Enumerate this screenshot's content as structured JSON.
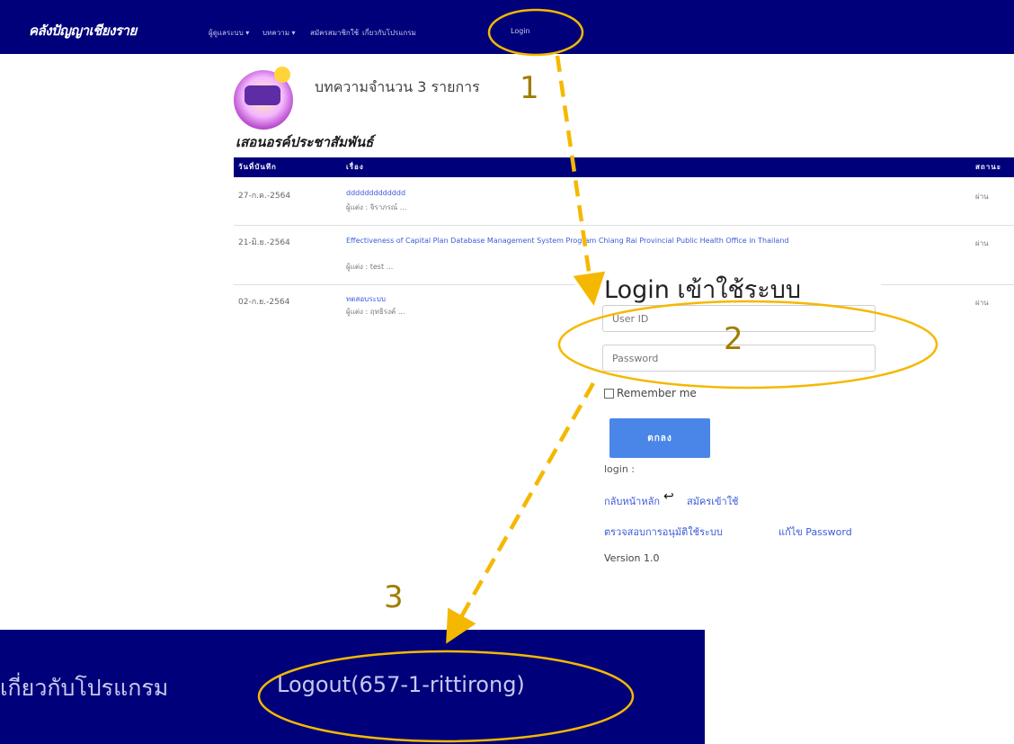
{
  "navbar": {
    "brand": "คลังปัญญาเชียงราย",
    "items": [
      "ผู้ดูแลระบบ ▾",
      "บทความ ▾",
      "สมัครสมาชิกใช้",
      "เกี่ยวกับโปรแกรม",
      "Login"
    ]
  },
  "articles": {
    "count_text": "บทความจำนวน 3 รายการ",
    "org_name": "เสอนอรค์ประชาสัมพันธ์",
    "columns": [
      "วันที่บันทึก",
      "เรื่อง",
      "สถานะ"
    ],
    "rows": [
      {
        "date": "27-ก.ค.-2564",
        "title": "ddddddddddddd",
        "author": "ผู้แต่ง : จิราภรณ์ ...",
        "status": "ผ่าน"
      },
      {
        "date": "21-มิ.ย.-2564",
        "title": "Effectiveness of Capital Plan Database Management System Program Chiang Rai Provincial Public Health Office in Thailand",
        "author": "ผู้แต่ง : test ...",
        "status": "ผ่าน"
      },
      {
        "date": "02-ก.ย.-2564",
        "title": "ทดสอบระบบ",
        "author": "ผู้แต่ง : ฤทธิรงค์ ...",
        "status": "ผ่าน"
      }
    ]
  },
  "login": {
    "title": "Login เข้าใช้ระบบ",
    "user_placeholder": "User ID",
    "password_placeholder": "Password",
    "remember_label": "Remember me",
    "submit_label": "ตกลง",
    "status_label": "login :",
    "back_link": "กลับหน้าหลัก",
    "register_link": "สมัครเข้าใช้",
    "verify_link": "ตรวจสอบการอนุมัติใช้ระบบ",
    "reset_link": "แก้ไข Password",
    "version": "Version 1.0"
  },
  "bottom_bar": {
    "about_text": "เกี่ยวกับโปรแกรม",
    "logout_text": "Logout(657-1-rittirong)"
  },
  "annotations": {
    "step1": "1",
    "step2": "2",
    "step3": "3"
  },
  "colors": {
    "navbar_bg": "#00007a",
    "button_bg": "#4a86e8",
    "annotation_yellow": "#f5b800",
    "annotation_number": "#a07d00"
  }
}
